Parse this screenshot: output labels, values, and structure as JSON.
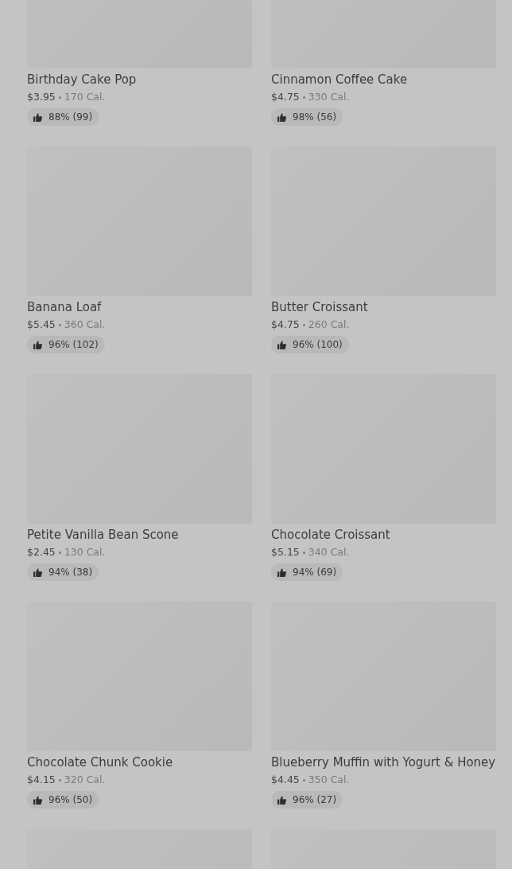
{
  "products": [
    {
      "kind": "card",
      "name": "Birthday Cake Pop",
      "price": "$3.95",
      "calories": "170 Cal.",
      "rating": "88% (99)"
    },
    {
      "kind": "card",
      "name": "Cinnamon Coffee Cake",
      "price": "$4.75",
      "calories": "330 Cal.",
      "rating": "98% (56)"
    },
    {
      "kind": "card",
      "name": "Banana Loaf",
      "price": "$5.45",
      "calories": "360 Cal.",
      "rating": "96% (102)"
    },
    {
      "kind": "card",
      "name": "Butter Croissant",
      "price": "$4.75",
      "calories": "260 Cal.",
      "rating": "96% (100)"
    },
    {
      "kind": "card",
      "name": "Petite Vanilla Bean Scone",
      "price": "$2.45",
      "calories": "130 Cal.",
      "rating": "94% (38)"
    },
    {
      "kind": "card",
      "name": "Chocolate Croissant",
      "price": "$5.15",
      "calories": "340 Cal.",
      "rating": "94% (69)"
    },
    {
      "kind": "card",
      "name": "Chocolate Chunk Cookie",
      "price": "$4.15",
      "calories": "320 Cal.",
      "rating": "96% (50)"
    },
    {
      "kind": "card",
      "name": "Blueberry Muffin with Yogurt & Honey",
      "price": "$4.45",
      "calories": "350 Cal.",
      "rating": "96% (27)"
    },
    {
      "kind": "image_only"
    },
    {
      "kind": "image_only"
    }
  ]
}
